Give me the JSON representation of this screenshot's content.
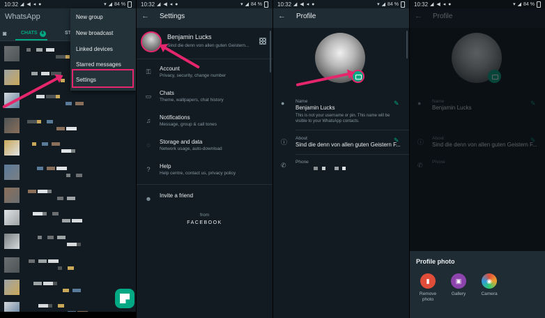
{
  "status_bar": {
    "time": "10:32",
    "battery": "84 %"
  },
  "panel1": {
    "app_title": "WhatsApp",
    "tabs": {
      "chats": "CHATS",
      "chats_badge": "4",
      "status": "ST"
    },
    "menu": [
      "New group",
      "New broadcast",
      "Linked devices",
      "Starred messages",
      "Settings"
    ]
  },
  "panel2": {
    "title": "Settings",
    "profile": {
      "name": "Benjamin Lucks",
      "about": "Sind die denn von allen guten Geistern..."
    },
    "items": [
      {
        "label": "Account",
        "sub": "Privacy, security, change number",
        "icon": "key-icon"
      },
      {
        "label": "Chats",
        "sub": "Theme, wallpapers, chat history",
        "icon": "chat-icon"
      },
      {
        "label": "Notifications",
        "sub": "Message, group & call tones",
        "icon": "bell-icon"
      },
      {
        "label": "Storage and data",
        "sub": "Network usage, auto-download",
        "icon": "storage-icon"
      },
      {
        "label": "Help",
        "sub": "Help centre, contact us, privacy policy",
        "icon": "help-icon"
      }
    ],
    "invite": "Invite a friend",
    "from": "from",
    "facebook": "FACEBOOK"
  },
  "panel3": {
    "title": "Profile",
    "name_label": "Name",
    "name_value": "Benjamin Lucks",
    "name_hint": "This is not your username or pin. This name will be visible to your WhatsApp contacts.",
    "about_label": "About",
    "about_value": "Sind die denn von allen guten Geistern F...",
    "phone_label": "Phone"
  },
  "panel4": {
    "title": "Profile",
    "name_label": "Name",
    "name_value": "Benjamin Lucks",
    "about_label": "About",
    "about_value": "Sind die denn von allen guten Geistern F...",
    "phone_label": "Phone",
    "sheet_title": "Profile photo",
    "options": [
      {
        "label": "Remove photo",
        "color": "#e04e3a",
        "icon": "trash-icon"
      },
      {
        "label": "Gallery",
        "color": "#8e44ad",
        "icon": "gallery-icon"
      },
      {
        "label": "Camera",
        "color": "#f0a030",
        "icon": "camera-icon"
      }
    ]
  },
  "colors": {
    "accent": "#00a884",
    "highlight": "#e6266c",
    "bg": "#121b22",
    "header": "#1f2c34"
  }
}
